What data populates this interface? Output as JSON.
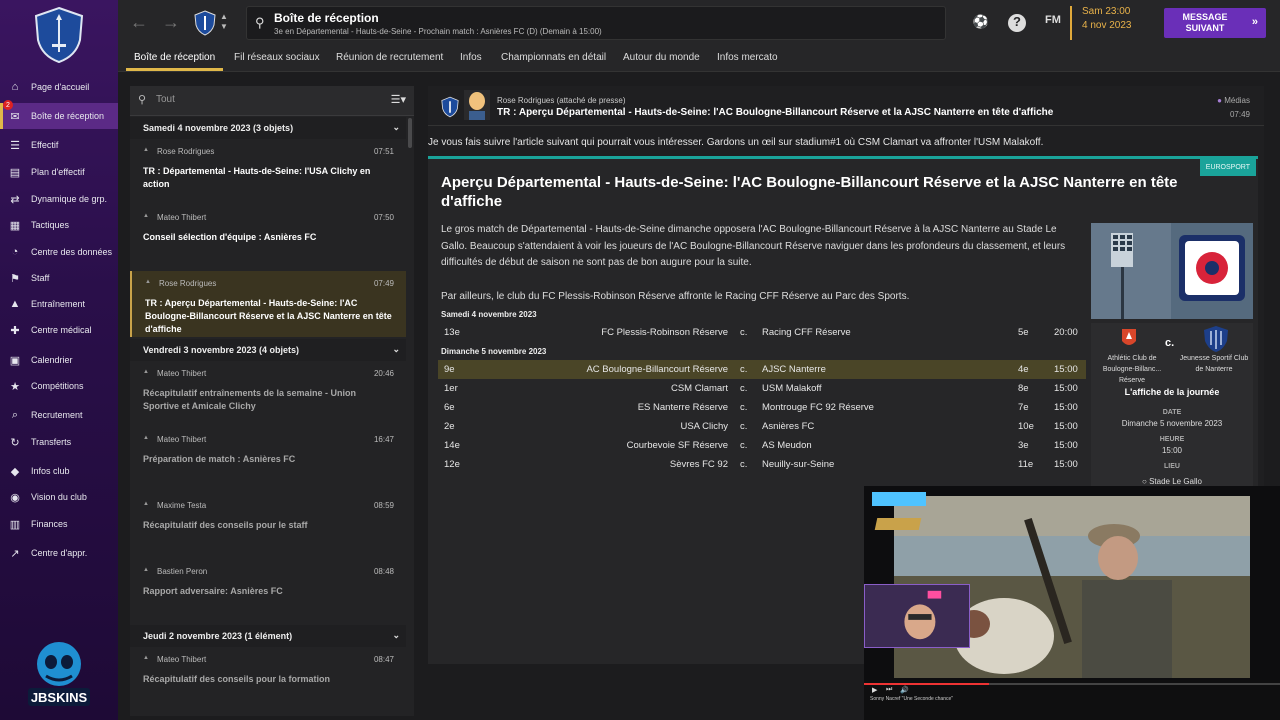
{
  "sidebar": {
    "items": [
      {
        "label": "Page d'accueil",
        "icon": "home-icon"
      },
      {
        "label": "Boîte de réception",
        "icon": "inbox-icon",
        "badge": "2"
      },
      {
        "label": "Effectif",
        "icon": "squad-icon"
      },
      {
        "label": "Plan d'effectif",
        "icon": "squad-plan-icon"
      },
      {
        "label": "Dynamique de grp.",
        "icon": "dynamics-icon"
      },
      {
        "label": "Tactiques",
        "icon": "tactics-icon"
      },
      {
        "label": "Centre des données",
        "icon": "data-hub-icon"
      },
      {
        "label": "Staff",
        "icon": "staff-icon"
      },
      {
        "label": "Entraînement",
        "icon": "training-icon"
      },
      {
        "label": "Centre médical",
        "icon": "medical-icon"
      },
      {
        "label": "Calendrier",
        "icon": "calendar-icon"
      },
      {
        "label": "Compétitions",
        "icon": "trophy-icon"
      },
      {
        "label": "Recrutement",
        "icon": "scouting-icon"
      },
      {
        "label": "Transferts",
        "icon": "transfers-icon"
      },
      {
        "label": "Infos club",
        "icon": "club-info-icon"
      },
      {
        "label": "Vision du club",
        "icon": "club-vision-icon"
      },
      {
        "label": "Finances",
        "icon": "finances-icon"
      },
      {
        "label": "Centre d'appr.",
        "icon": "learning-icon"
      }
    ],
    "logo_text": "JBSKINS"
  },
  "topbar": {
    "title": "Boîte de réception",
    "subtitle": "3e en Départemental - Hauts-de-Seine - Prochain match : Asnières FC (D) (Demain à 15:00)",
    "fm_label": "FM",
    "date_line1": "Sam 23:00",
    "date_line2": "4 nov 2023",
    "next_button": "MESSAGE SUIVANT"
  },
  "tabs": [
    "Boîte de réception",
    "Fil réseaux sociaux",
    "Réunion de recrutement",
    "Infos",
    "Championnats en détail",
    "Autour du monde",
    "Infos mercato"
  ],
  "inbox": {
    "search_placeholder": "Tout",
    "groups": [
      {
        "header": "Samedi 4 novembre 2023 (3 objets)",
        "messages": [
          {
            "from": "Rose Rodrigues",
            "time": "07:51",
            "subject": "TR : Départemental - Hauts-de-Seine: l'USA Clichy en action",
            "read": false
          },
          {
            "from": "Mateo Thibert",
            "time": "07:50",
            "subject": "Conseil sélection d'équipe : Asnières FC",
            "read": false
          },
          {
            "from": "Rose Rodrigues",
            "time": "07:49",
            "subject": "TR : Aperçu Départemental - Hauts-de-Seine: l'AC Boulogne-Billancourt Réserve et la AJSC Nanterre en tête d'affiche",
            "read": false,
            "selected": true
          }
        ]
      },
      {
        "header": "Vendredi 3 novembre 2023 (4 objets)",
        "messages": [
          {
            "from": "Mateo Thibert",
            "time": "20:46",
            "subject": "Récapitulatif entraînements de la semaine - Union Sportive et Amicale Clichy",
            "read": true
          },
          {
            "from": "Mateo Thibert",
            "time": "16:47",
            "subject": "Préparation de match : Asnières FC",
            "read": true
          },
          {
            "from": "Maxime Testa",
            "time": "08:59",
            "subject": "Récapitulatif des conseils pour le staff",
            "read": true
          },
          {
            "from": "Bastien Peron",
            "time": "08:48",
            "subject": "Rapport adversaire: Asnières FC",
            "read": true
          }
        ]
      },
      {
        "header": "Jeudi 2 novembre 2023 (1 élément)",
        "messages": [
          {
            "from": "Mateo Thibert",
            "time": "08:47",
            "subject": "Récapitulatif des conseils pour la formation",
            "read": true
          }
        ]
      }
    ]
  },
  "reader": {
    "sender": "Rose Rodrigues  (attaché de presse)",
    "subject": "TR : Aperçu Départemental - Hauts-de-Seine: l'AC Boulogne-Billancourt Réserve et la AJSC Nanterre en tête d'affiche",
    "media_tag": "Médias",
    "time": "07:49",
    "intro": "Je vous fais suivre l'article suivant qui pourrait vous intéresser. Gardons un œil sur stadium#1 où CSM Clamart va affronter l'USM Malakoff.",
    "source": "EUROSPORT",
    "article_title": "Aperçu Départemental - Hauts-de-Seine: l'AC Boulogne-Billancourt Réserve et la AJSC Nanterre en tête d'affiche",
    "paragraph1": "Le gros match de Départemental - Hauts-de-Seine dimanche opposera l'AC Boulogne-Billancourt Réserve à la AJSC Nanterre au Stade Le Gallo. Beaucoup s'attendaient à voir les joueurs de l'AC Boulogne-Billancourt Réserve naviguer dans les profondeurs du classement, et leurs difficultés de début de saison ne sont pas de bon augure pour la suite.",
    "paragraph2": "Par ailleurs, le club du FC Plessis-Robinson Réserve affronte le Racing CFF Réserve au Parc des Sports.",
    "fixtures": [
      {
        "day": "Samedi 4 novembre 2023",
        "rows": [
          {
            "pos1": "13e",
            "home": "FC Plessis-Robinson Réserve",
            "vs": "c.",
            "away": "Racing CFF Réserve",
            "pos2": "5e",
            "ko": "20:00"
          }
        ]
      },
      {
        "day": "Dimanche 5 novembre 2023",
        "rows": [
          {
            "pos1": "9e",
            "home": "AC Boulogne-Billancourt Réserve",
            "vs": "c.",
            "away": "AJSC Nanterre",
            "pos2": "4e",
            "ko": "15:00",
            "highlight": true
          },
          {
            "pos1": "1er",
            "home": "CSM Clamart",
            "vs": "c.",
            "away": "USM Malakoff",
            "pos2": "8e",
            "ko": "15:00"
          },
          {
            "pos1": "6e",
            "home": "ES Nanterre Réserve",
            "vs": "c.",
            "away": "Montrouge FC 92 Réserve",
            "pos2": "7e",
            "ko": "15:00"
          },
          {
            "pos1": "2e",
            "home": "USA Clichy",
            "vs": "c.",
            "away": "Asnières FC",
            "pos2": "10e",
            "ko": "15:00"
          },
          {
            "pos1": "14e",
            "home": "Courbevoie SF Réserve",
            "vs": "c.",
            "away": "AS Meudon",
            "pos2": "3e",
            "ko": "15:00"
          },
          {
            "pos1": "12e",
            "home": "Sèvres FC 92",
            "vs": "c.",
            "away": "Neuilly-sur-Seine",
            "pos2": "11e",
            "ko": "15:00"
          }
        ]
      }
    ],
    "card": {
      "home_team": "Athlétic Club de Boulogne-Billanc... Réserve",
      "vs": "c.",
      "away_team": "Jeunesse Sportif Club de Nanterre",
      "headline": "L'affiche de la journée",
      "date_label": "DATE",
      "date_value": "Dimanche 5 novembre 2023",
      "time_label": "HEURE",
      "time_value": "15:00",
      "venue_label": "LIEU",
      "venue_value": "Stade Le Gallo"
    }
  },
  "video_overlay": {
    "title": "Sonny Nacref \"Une Seconde chance\""
  },
  "colors": {
    "sidebar_purple": "#3a1560",
    "accent_gold": "#e0b84a",
    "next_button": "#6a2fb8",
    "eurosport_teal": "#1aa39a",
    "highlight_row": "#4a4527"
  }
}
